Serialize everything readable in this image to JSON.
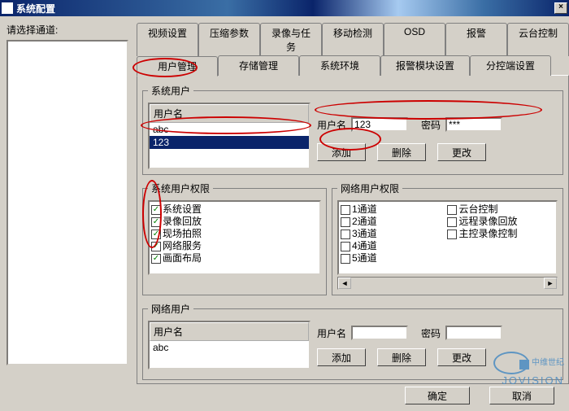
{
  "window": {
    "title": "系统配置",
    "close": "×"
  },
  "left": {
    "label": "请选择通道:"
  },
  "tabs_row1": [
    "视频设置",
    "压缩参数",
    "录像与任务",
    "移动检测",
    "OSD",
    "报警",
    "云台控制"
  ],
  "tabs_row2": [
    "用户管理",
    "存储管理",
    "系统环境",
    "报警模块设置",
    "分控端设置"
  ],
  "active_tab": "用户管理",
  "sys_user": {
    "legend": "系统用户",
    "col_header": "用户名",
    "rows": [
      "abc",
      "123"
    ],
    "selected": 1,
    "user_label": "用户名",
    "user_value": "123",
    "pwd_label": "密码",
    "pwd_value": "***",
    "btn_add": "添加",
    "btn_del": "删除",
    "btn_mod": "更改"
  },
  "sys_perm": {
    "legend": "系统用户权限",
    "items": [
      {
        "label": "系统设置",
        "checked": true
      },
      {
        "label": "录像回放",
        "checked": true
      },
      {
        "label": "现场拍照",
        "checked": true
      },
      {
        "label": "网络服务",
        "checked": true
      },
      {
        "label": "画面布局",
        "checked": true
      }
    ]
  },
  "net_perm": {
    "legend": "网络用户权限",
    "col1": [
      {
        "label": "1通道",
        "checked": false
      },
      {
        "label": "2通道",
        "checked": false
      },
      {
        "label": "3通道",
        "checked": false
      },
      {
        "label": "4通道",
        "checked": false
      },
      {
        "label": "5通道",
        "checked": false
      }
    ],
    "col2": [
      {
        "label": "云台控制",
        "checked": false
      },
      {
        "label": "远程录像回放",
        "checked": false
      },
      {
        "label": "主控录像控制",
        "checked": false
      }
    ]
  },
  "net_user": {
    "legend": "网络用户",
    "col_header": "用户名",
    "rows": [
      "abc"
    ],
    "user_label": "用户名",
    "user_value": "",
    "pwd_label": "密码",
    "pwd_value": "",
    "btn_add": "添加",
    "btn_del": "删除",
    "btn_mod": "更改"
  },
  "footer": {
    "ok": "确定",
    "cancel": "取消"
  },
  "watermark": {
    "cn": "中维世纪",
    "en": "JOVISION"
  }
}
